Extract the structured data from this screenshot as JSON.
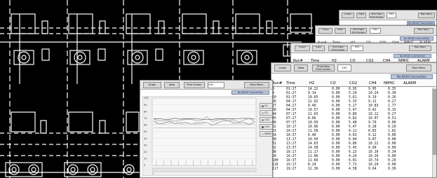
{
  "windows": {
    "back1": {
      "buttons": [
        "Graph",
        "Data",
        "Print Data\nPrint Screen",
        "CH2",
        "Main Menu"
      ],
      "status": "No BGAS Connection",
      "columns": [
        "Run#",
        "Time",
        "H2",
        "CO",
        "CO2",
        "CH4",
        "NMHC",
        "ALARM"
      ],
      "first_row": [
        "",
        "01:17",
        "14.22",
        "0.00",
        "6.93",
        "9.95",
        "0.35"
      ]
    },
    "back2": {
      "buttons": [
        "Graph",
        "Data",
        "Print Data\nPrint Screen",
        "CH2",
        "Main Menu"
      ],
      "status": "No BGAS Connection",
      "columns": [
        "Run#",
        "Time",
        "H2",
        "CO",
        "CO2",
        "CH4",
        "NMHC",
        "ALARM"
      ]
    },
    "back3": {
      "buttons": [
        "Graph",
        "Data",
        "Print Data\nPrint Screen",
        "CH2",
        "Main Menu"
      ],
      "status": "No BGAS Connection",
      "columns": [
        "Run#",
        "Time",
        "H2",
        "CO",
        "CO2",
        "CH4",
        "NMHC",
        "ALARM"
      ]
    },
    "main": {
      "buttons": [
        "Graph",
        "Data",
        "Print Data\nPrint Screen",
        "CH2",
        "Main Menu"
      ],
      "status": "No BGAS Connection",
      "columns": [
        "Run#",
        "Time",
        "H2",
        "CO",
        "CO2",
        "CH4",
        "NMHC",
        "ALARM"
      ],
      "rows": [
        [
          "8",
          "01:17",
          "14.22",
          "0.00",
          "6.93",
          "9.95",
          "0.35"
        ],
        [
          "9",
          "01:27",
          "9.14",
          "0.00",
          "5.24",
          "10.24",
          "0.30"
        ],
        [
          "10",
          "01:37",
          "10.65",
          "0.00",
          "5.61",
          "9.19",
          "0.26"
        ],
        [
          "26",
          "04:17",
          "12.92",
          "0.00",
          "5.33",
          "9.12",
          "0.27"
        ],
        [
          "27",
          "04:27",
          "9.40",
          "0.00",
          "5.27",
          "10.83",
          "1.77"
        ],
        [
          "28",
          "04:37",
          "10.57",
          "0.00",
          "5.47",
          "9.42",
          "0.15"
        ],
        [
          "44",
          "07:17",
          "11.63",
          "0.00",
          "6.89",
          "10.12",
          "0.27"
        ],
        [
          "45",
          "07:27",
          "8.66",
          "0.00",
          "6.82",
          "10.07",
          "0.51"
        ],
        [
          "46",
          "07:37",
          "10.56",
          "0.00",
          "5.48",
          "9.79",
          "0.00"
        ],
        [
          "62",
          "10:17",
          "10.96",
          "0.00",
          "5.47",
          "9.28",
          "0.29"
        ],
        [
          "63",
          "10:27",
          "11.58",
          "0.00",
          "9.11",
          "8.83",
          "1.02"
        ],
        [
          "64",
          "10:37",
          "6.40",
          "0.00",
          "4.63",
          "9.12",
          "0.00"
        ],
        [
          "80",
          "13:17",
          "10.50",
          "0.00",
          "6.04",
          "9.87",
          "0.00"
        ],
        [
          "81",
          "13:27",
          "14.63",
          "0.00",
          "6.86",
          "10.22",
          "0.00"
        ],
        [
          "82",
          "13:37",
          "14.58",
          "0.00",
          "5.45",
          "9.99",
          "0.00"
        ],
        [
          "98",
          "16:17",
          "11.17",
          "0.00",
          "6.23",
          "10.10",
          "0.34"
        ],
        [
          "99",
          "16:27",
          "11.06",
          "0.00",
          "4.24",
          "10.26",
          "0.00"
        ],
        [
          "100",
          "16:37",
          "11.66",
          "0.00",
          "6.01",
          "10.74",
          "0.29"
        ],
        [
          "116",
          "19:17",
          "8.24",
          "0.00",
          "7.72",
          "10.29",
          "0.00"
        ],
        [
          "117",
          "19:27",
          "12.36",
          "0.00",
          "4.58",
          "9.64",
          "0.30"
        ]
      ]
    },
    "graph": {
      "buttons": [
        "Graph",
        "Data",
        "Print Screen",
        "CH2",
        "Main Menu"
      ],
      "status": "No BGAS Connection",
      "y_ticks": [
        "100",
        "90",
        "80",
        "70",
        "60",
        "50",
        "40",
        "30",
        "20",
        "10",
        "0"
      ],
      "legend": [
        "H2",
        "CO",
        "CO2",
        "CH4",
        "NMHC"
      ],
      "series_colors": [
        "#7a7a7a",
        "#b7b7b7",
        "#9a9a9a",
        "#5e5e5e",
        "#c9c9c9"
      ],
      "bottom_tick": "1"
    }
  },
  "colors": {
    "background": "#000000",
    "schematic_lines": "#ffffff",
    "status_bg": "#b9c4d6"
  }
}
